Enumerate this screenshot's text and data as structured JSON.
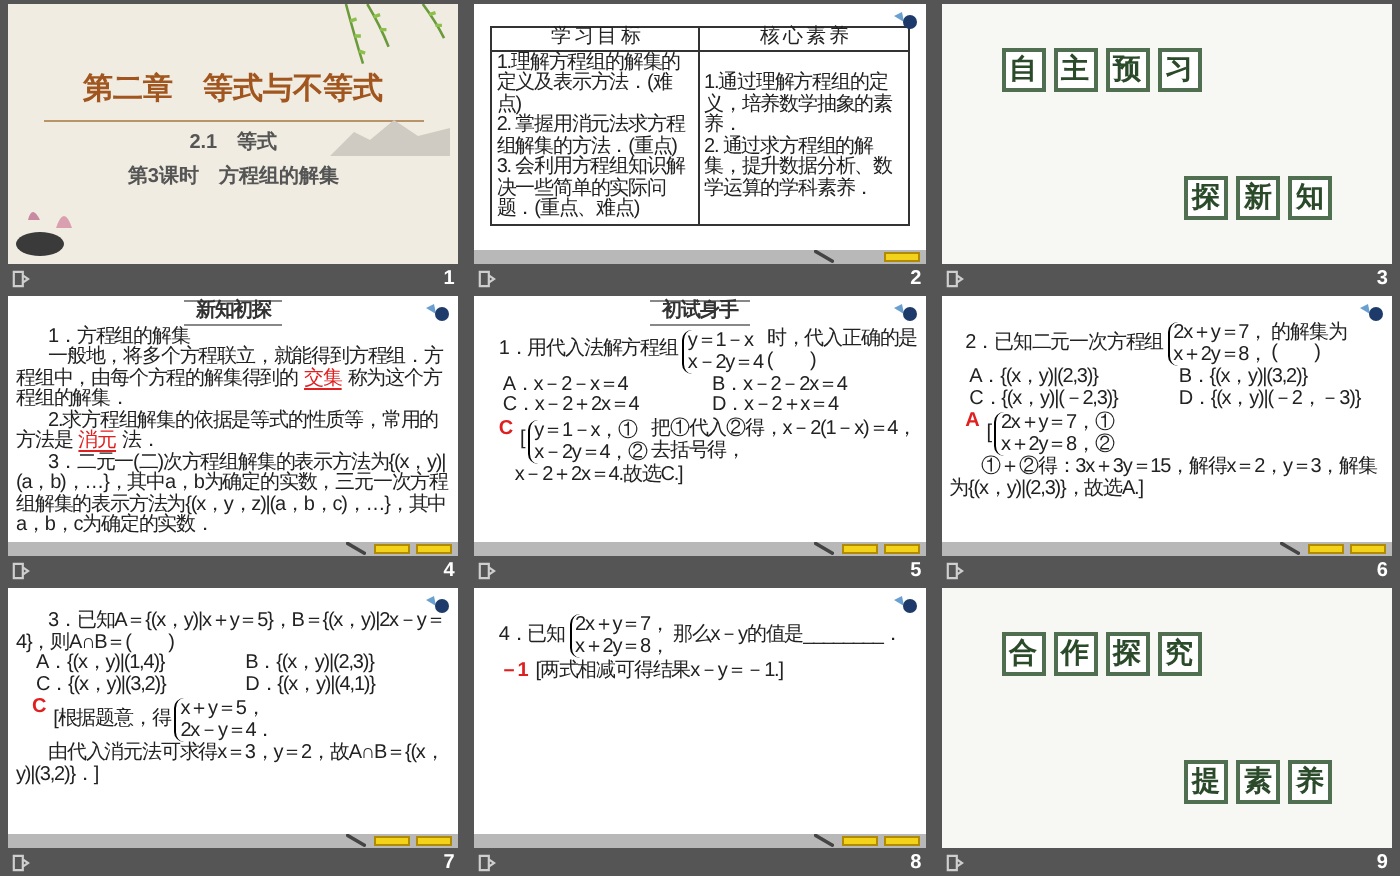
{
  "slides": [
    {
      "number": "1",
      "kind": "title",
      "chapter": "第二章　等式与不等式",
      "section": "2.1　等式",
      "lesson": "第3课时　方程组的解集"
    },
    {
      "number": "2",
      "kind": "table",
      "columns": [
        "学 习 目 标",
        "核 心 素 养"
      ],
      "cells": [
        [
          "1.理解方程组的解集的定义及表示方法．(难点)",
          "2. 掌握用消元法求方程组解集的方法．(重点)",
          "3. 会利用方程组知识解决一些简单的实际问题．(重点、难点)"
        ],
        [
          "1.通过理解方程组的定义，培养数学抽象的素养．",
          "2. 通过求方程组的解集，提升数据分析、数学运算的学科素养．"
        ]
      ]
    },
    {
      "number": "3",
      "kind": "section",
      "top": [
        "自",
        "主",
        "预",
        "习"
      ],
      "bottom": [
        "探",
        "新",
        "知"
      ]
    },
    {
      "number": "4",
      "kind": "content",
      "header": "新知初探",
      "blocks": [
        {
          "kind": "para",
          "parts": [
            {
              "kind": "text",
              "text": "1．方程组的解集"
            }
          ]
        },
        {
          "kind": "para",
          "parts": [
            {
              "kind": "text",
              "text": "一般地，将多个方程联立，就能得到方程组．方程组中，由每个方程的解集得到的"
            },
            {
              "kind": "fill",
              "text": "交集"
            },
            {
              "kind": "text",
              "text": "称为这个方程组的解集．"
            }
          ]
        },
        {
          "kind": "para",
          "parts": [
            {
              "kind": "text",
              "text": "2.求方程组解集的依据是等式的性质等，常用的方法是"
            },
            {
              "kind": "fill",
              "text": "消元"
            },
            {
              "kind": "text",
              "text": "法．"
            }
          ]
        },
        {
          "kind": "para",
          "parts": [
            {
              "kind": "text",
              "text": "3．二元一(二)次方程组解集的表示方法为{(x，y)|(a，b)，…}，其中a，b为确定的实数，三元一次方程组解集的表示方法为{(x，y，z)|(a，b，c)，…}，其中a，b，c为确定的实数．"
            }
          ]
        }
      ]
    },
    {
      "number": "5",
      "kind": "content",
      "header": "初试身手",
      "blocks": [
        {
          "kind": "line",
          "parts": [
            {
              "kind": "text",
              "text": "1．用代入法解方程组"
            },
            {
              "kind": "system",
              "lines": [
                "y＝1－x",
                "x－2y＝4"
              ]
            },
            {
              "kind": "text",
              "text": "时，代入正确的是(　　)"
            }
          ]
        },
        {
          "kind": "options",
          "items": [
            "A．x－2－x＝4",
            "B．x－2－2x＝4",
            "C．x－2＋2x＝4",
            "D．x－2＋x＝4"
          ]
        },
        {
          "kind": "line",
          "parts": [
            {
              "kind": "mark",
              "text": "C"
            },
            {
              "kind": "text",
              "text": "["
            },
            {
              "kind": "system",
              "lines": [
                "y＝1－x，①",
                "x－2y＝4，②"
              ]
            },
            {
              "kind": "text",
              "text": "把①代入②得，x－2(1－x)＝4，去括号得，"
            }
          ]
        },
        {
          "kind": "para",
          "parts": [
            {
              "kind": "text",
              "text": "x－2＋2x＝4.故选C.]"
            }
          ]
        }
      ]
    },
    {
      "number": "6",
      "kind": "content",
      "blocks": [
        {
          "kind": "line",
          "parts": [
            {
              "kind": "text",
              "text": "2．已知二元一次方程组"
            },
            {
              "kind": "system",
              "lines": [
                "2x＋y＝7，",
                "x＋2y＝8，"
              ]
            },
            {
              "kind": "text",
              "text": "的解集为(　　)"
            }
          ]
        },
        {
          "kind": "options",
          "items": [
            "A．{(x，y)|(2,3)}",
            "B．{(x，y)|(3,2)}",
            "C．{(x，y)|(－2,3)}",
            "D．{(x，y)|(－2，－3)}"
          ]
        },
        {
          "kind": "line",
          "parts": [
            {
              "kind": "mark",
              "text": "A"
            },
            {
              "kind": "text",
              "text": "["
            },
            {
              "kind": "system",
              "lines": [
                "2x＋y＝7，①",
                "x＋2y＝8，②"
              ]
            }
          ]
        },
        {
          "kind": "para",
          "parts": [
            {
              "kind": "text",
              "text": "①＋②得：3x＋3y＝15，解得x＝2，y＝3，解集为{(x，y)|(2,3)}，故选A.]"
            }
          ]
        }
      ]
    },
    {
      "number": "7",
      "kind": "content",
      "blocks": [
        {
          "kind": "para",
          "parts": [
            {
              "kind": "text",
              "text": "3．已知A＝{(x，y)|x＋y＝5}，B＝{(x，y)|2x－y＝4}，则A∩B＝(　　)"
            }
          ]
        },
        {
          "kind": "options",
          "items": [
            "A．{(x，y)|(1,4)}",
            "B．{(x，y)|(2,3)}",
            "C．{(x，y)|(3,2)}",
            "D．{(x，y)|(4,1)}"
          ]
        },
        {
          "kind": "line",
          "parts": [
            {
              "kind": "mark",
              "text": "C"
            },
            {
              "kind": "text",
              "text": "[根据题意，得"
            },
            {
              "kind": "system",
              "lines": [
                "x＋y＝5，",
                "2x－y＝4．"
              ]
            }
          ]
        },
        {
          "kind": "para",
          "parts": [
            {
              "kind": "text",
              "text": "由代入消元法可求得x＝3，y＝2，故A∩B＝{(x，y)|(3,2)}．]"
            }
          ]
        }
      ]
    },
    {
      "number": "8",
      "kind": "content",
      "blocks": [
        {
          "kind": "line",
          "parts": [
            {
              "kind": "text",
              "text": "4．已知"
            },
            {
              "kind": "system",
              "lines": [
                "2x＋y＝7，",
                "x＋2y＝8，"
              ]
            },
            {
              "kind": "text",
              "text": "那么x－y的值是________．"
            }
          ]
        },
        {
          "kind": "line",
          "parts": [
            {
              "kind": "mark",
              "text": "－1"
            },
            {
              "kind": "text",
              "text": "[两式相减可得结果x－y＝－1.]"
            }
          ]
        }
      ]
    },
    {
      "number": "9",
      "kind": "section",
      "top": [
        "合",
        "作",
        "探",
        "究"
      ],
      "bottom": [
        "提",
        "素",
        "养"
      ]
    }
  ]
}
